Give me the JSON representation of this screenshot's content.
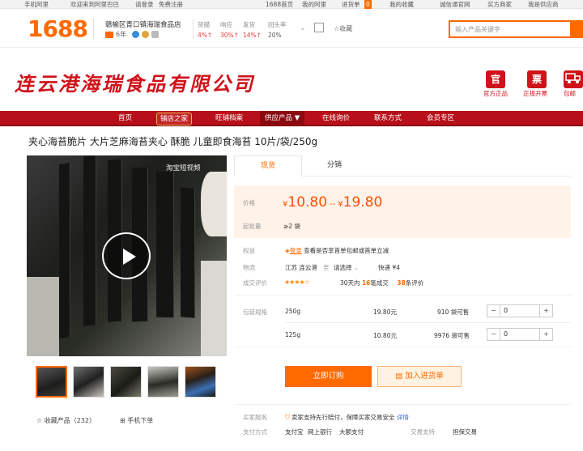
{
  "topbar": {
    "mobile": "手机阿里",
    "welcome": "欢迎来到阿里巴巴",
    "login": "请登录",
    "register": "免费注册",
    "home": "1688首页",
    "my_alibaba": "我的阿里",
    "cart": "进货单",
    "cart_count": "0",
    "favorites": "我的收藏",
    "trust": "诚信通官网",
    "buy_service": "买方商家",
    "seller": "我是供应商"
  },
  "header": {
    "logo": "1688",
    "shop_name": "赣榆区青口镇海瑞食品店",
    "years": "6年",
    "stats": [
      {
        "label": "货描",
        "value": "4%↑"
      },
      {
        "label": "响应",
        "value": "30%↑"
      },
      {
        "label": "发货",
        "value": "14%↑"
      },
      {
        "label": "回头率",
        "value": "20%"
      }
    ],
    "follow": "收藏",
    "search_placeholder": "输入产品关键字"
  },
  "banner": {
    "company": "连云港海瑞食品有限公司",
    "icons": [
      {
        "glyph": "官",
        "label": "官方正品"
      },
      {
        "glyph": "票",
        "label": "正规开票"
      },
      {
        "glyph": "",
        "label": "包邮"
      }
    ]
  },
  "nav": {
    "items": [
      "首页",
      "旺铺档案",
      "供应产品 ▼",
      "在线询价",
      "联系方式",
      "会员专区"
    ],
    "shop_badge": "铺店之家"
  },
  "product": {
    "title": "夹心海苔脆片 大片芝麻海苔夹心 酥脆 儿童即食海苔 10片/袋/250g",
    "video_watermark": "淘宝短视频",
    "favorite": "收藏产品（232）",
    "mobile_order": "手机下单"
  },
  "tabs": [
    "现货",
    "分销"
  ],
  "price": {
    "label": "价格",
    "low": "10.80",
    "high": "19.80",
    "currency": "¥",
    "sep": "--",
    "min_label": "起批量",
    "min_value": "≥2 袋"
  },
  "info": {
    "benefit_label": "权益",
    "benefit_text": "查看是否享首单包邮或首单立减",
    "benefit_badge": "登录",
    "logistics_label": "物流",
    "from": "江苏 连云港",
    "to_label": "至",
    "to": "请选择",
    "express": "快递 ¥4",
    "rating_label": "成交评价",
    "stars": "★★★★☆",
    "deals_prefix": "30天内",
    "deals_count": "16",
    "deals_suffix": "笔成交",
    "reviews_count": "38",
    "reviews_suffix": "条评价"
  },
  "sku": {
    "label": "包装规格",
    "rows": [
      {
        "spec": "250g",
        "price": "19.80元",
        "stock": "910 袋可售",
        "qty": "0"
      },
      {
        "spec": "125g",
        "price": "10.80元",
        "stock": "9976 袋可售",
        "qty": "0"
      }
    ]
  },
  "actions": {
    "buy": "立即订购",
    "cart": "加入进货单"
  },
  "service": {
    "buyer_label": "买家服务",
    "buyer_text": "卖家支持先行赔付，保障买家交易安全",
    "detail": "详情",
    "pay_label": "支付方式",
    "pay_methods": [
      "支付宝",
      "网上银行",
      "大额支付"
    ],
    "trade_label": "交易支持",
    "trade_value": "担保交易"
  }
}
